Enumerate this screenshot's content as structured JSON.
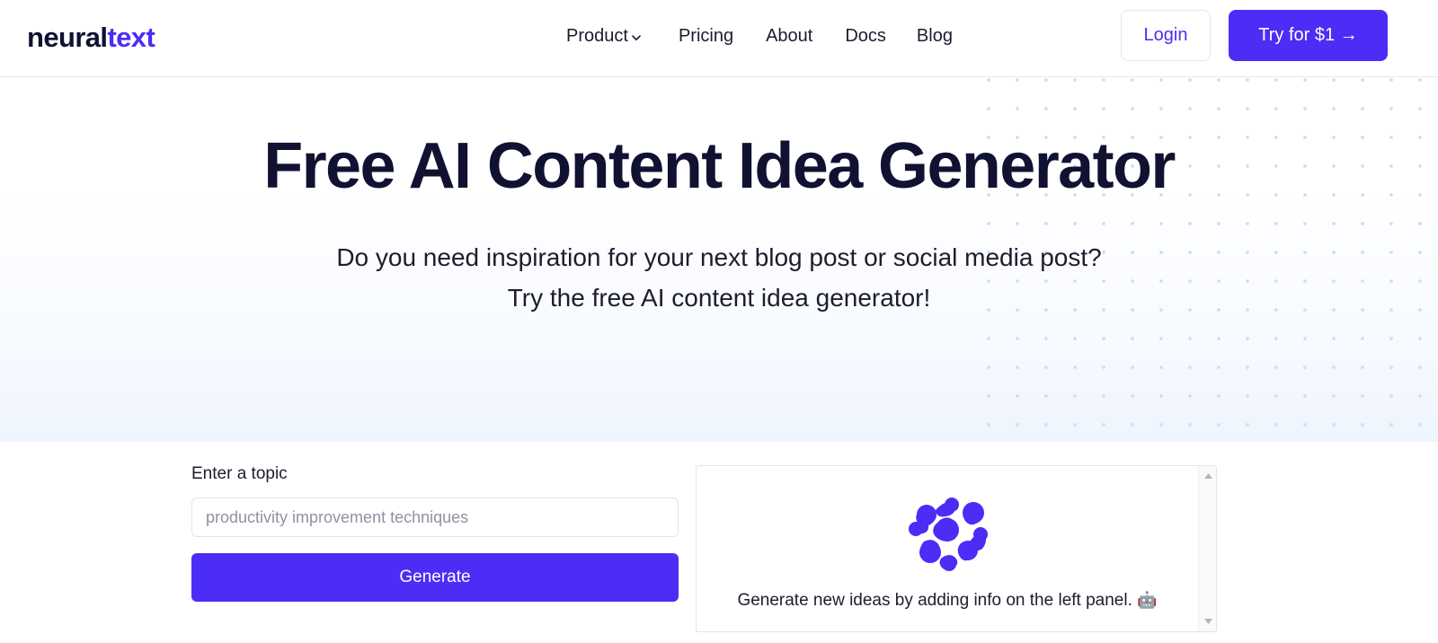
{
  "header": {
    "logo": {
      "part1": "neural",
      "part2": "text"
    },
    "nav": [
      {
        "label": "Product",
        "icon": "chevron-down-icon",
        "has_dropdown": true
      },
      {
        "label": "Pricing",
        "has_dropdown": false
      },
      {
        "label": "About",
        "has_dropdown": false
      },
      {
        "label": "Docs",
        "has_dropdown": false
      },
      {
        "label": "Blog",
        "has_dropdown": false
      }
    ],
    "login_label": "Login",
    "cta_label": "Try for $1 →"
  },
  "hero": {
    "title": "Free AI Content Idea Generator",
    "subtitle_line1": "Do you need inspiration for your next blog post or social media post?",
    "subtitle_line2": "Try the free AI content idea generator!"
  },
  "generator": {
    "topic_label": "Enter a topic",
    "topic_value": "",
    "topic_placeholder": "productivity improvement techniques",
    "generate_label": "Generate",
    "results": {
      "logo_icon": "neuraltext-nodes-icon",
      "empty_message": "Generate new ideas by adding info on the left panel.",
      "empty_emoji": "🤖"
    }
  },
  "colors": {
    "brand_purple": "#4b2df5",
    "ink": "#111132",
    "dot_grid": "#d5d9f3",
    "border": "#e2e4ec",
    "hero_gradient_end": "#eff5fe",
    "placeholder": "#8e93a3"
  }
}
